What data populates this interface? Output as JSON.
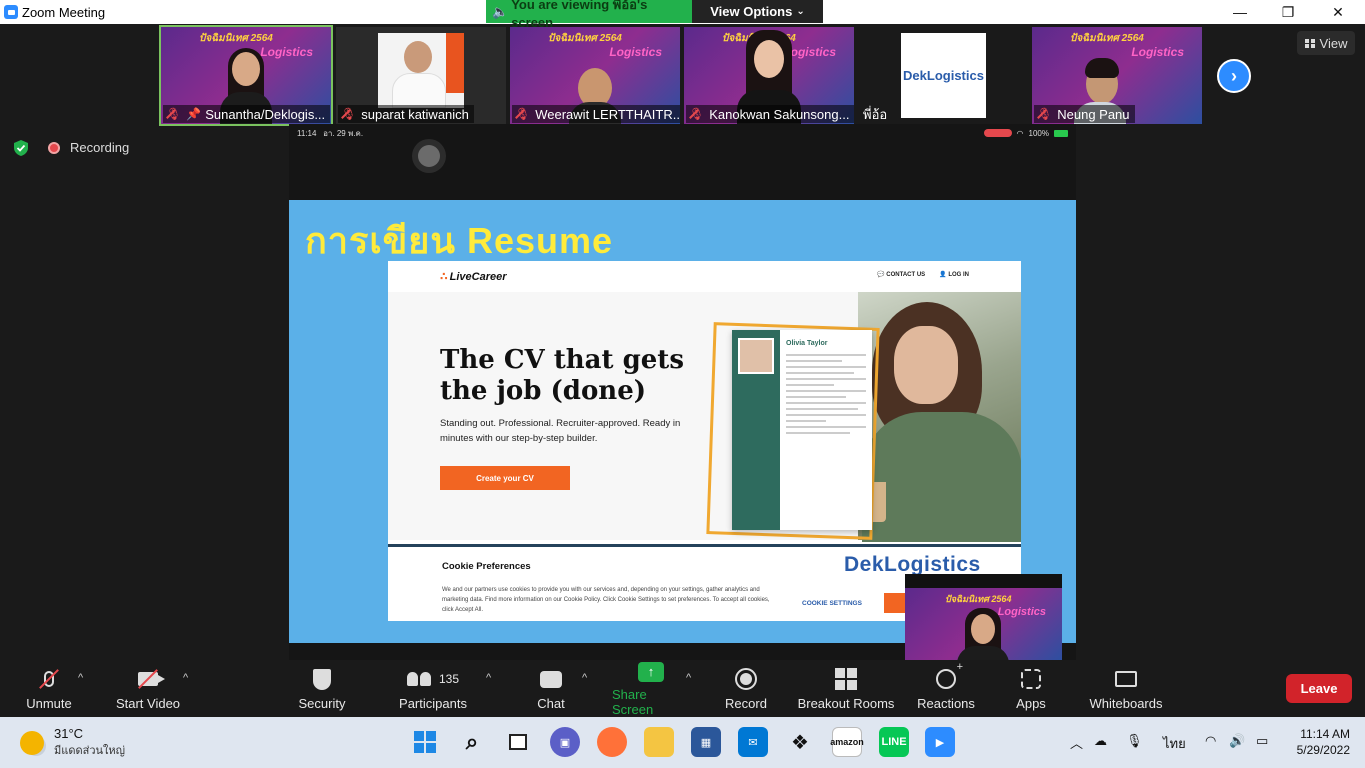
{
  "window": {
    "title": "Zoom Meeting",
    "minimize_glyph": "—",
    "maximize_glyph": "❐",
    "close_glyph": "✕"
  },
  "viewing_banner": {
    "text": "You are viewing พี่อ้อ's screen",
    "view_options": "View Options",
    "color": "#22b14c"
  },
  "participants": [
    {
      "name": "Sunantha/Deklogis...",
      "muted": true,
      "pinned": true,
      "active": true
    },
    {
      "name": "suparat katiwanich",
      "muted": true
    },
    {
      "name": "Weerawit LERTTHAITR...",
      "muted": true
    },
    {
      "name": "Kanokwan Sakunsong...",
      "muted": true
    },
    {
      "name": "พี่อ้อ",
      "muted": false,
      "logo": "DekLogistics"
    },
    {
      "name": "Neung Panu",
      "muted": true
    }
  ],
  "thumb_banner": "ปัจฉิมนิเทศ 2564",
  "thumb_logistics": "Logistics",
  "view_button": "View",
  "recording_label": "Recording",
  "shared_screen": {
    "status_time": "11:14",
    "status_date": "อา. 29 พ.ค.",
    "status_battery": "100%",
    "slide_title": "การเขียน Resume",
    "web": {
      "logo": "LiveCareer",
      "nav_contact": "CONTACT US",
      "nav_login": "LOG IN",
      "hero_title": "The CV that gets the job (done)",
      "hero_sub": "Standing out. Professional. Recruiter-approved. Ready in minutes with our step-by-step builder.",
      "cta": "Create your CV",
      "cv_name": "Olivia Taylor",
      "cookie_title": "Cookie Preferences",
      "cookie_text": "We and our partners use cookies to provide you with our services and, depending on your settings, gather analytics and marketing data. Find more information on our Cookie Policy. Click Cookie Settings to set preferences. To accept all cookies, click Accept All.",
      "cookie_settings": "COOKIE SETTINGS",
      "watermark": "DekLogistics"
    }
  },
  "toolbar": {
    "unmute": "Unmute",
    "start_video": "Start Video",
    "security": "Security",
    "participants": "Participants",
    "participants_count": "135",
    "chat": "Chat",
    "share_screen": "Share Screen",
    "record": "Record",
    "breakout_rooms": "Breakout Rooms",
    "reactions": "Reactions",
    "apps": "Apps",
    "whiteboards": "Whiteboards",
    "leave": "Leave"
  },
  "taskbar": {
    "temperature": "31°C",
    "weather_desc": "มีแดดส่วนใหญ่",
    "language": "ไทย",
    "time": "11:14 AM",
    "date": "5/29/2022",
    "amazon": "amazon"
  },
  "colors": {
    "accent_blue": "#2d8cff",
    "leave_red": "#d2232a",
    "share_green": "#22b14c",
    "slide_blue": "#5bb0e8",
    "cta_orange": "#f26522"
  }
}
